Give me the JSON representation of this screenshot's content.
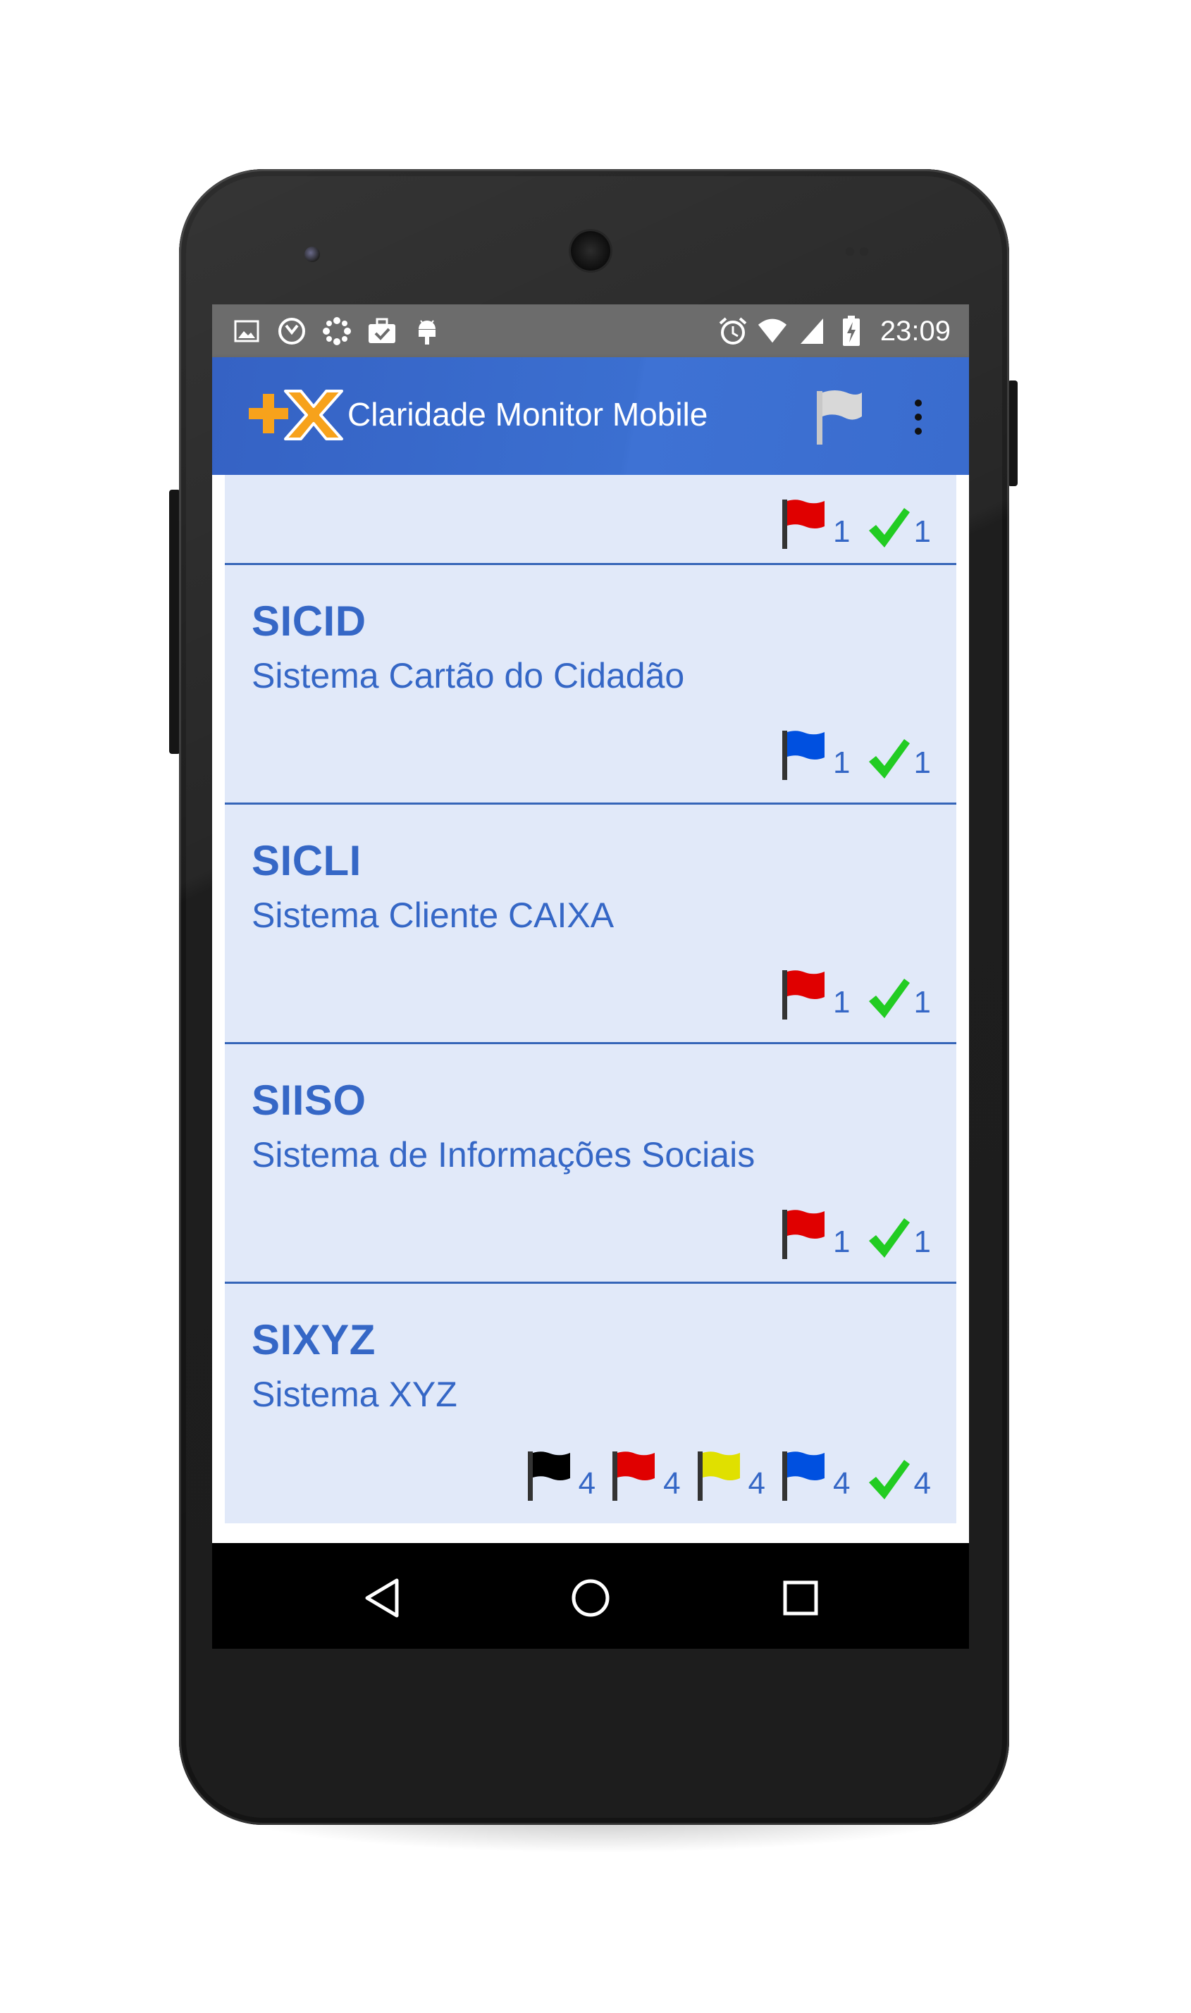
{
  "status_bar": {
    "time": "23:09",
    "left_icons": [
      "image-icon",
      "clock-app-icon",
      "dots-icon",
      "briefcase-check-icon",
      "android-debug-icon"
    ],
    "right_icons": [
      "alarm-icon",
      "wifi-icon",
      "signal-icon",
      "battery-charging-icon"
    ]
  },
  "app_bar": {
    "title": "Claridade Monitor Mobile",
    "logo": "plus-x-logo",
    "actions": [
      "flag-filter-icon",
      "overflow-menu-icon"
    ]
  },
  "colors": {
    "app_bar": "#3a6cce",
    "card_background": "#e1e9f9",
    "text_blue": "#3567c6",
    "flag_red": "#e00000",
    "flag_blue": "#0050e0",
    "flag_yellow": "#e0e000",
    "flag_black": "#000000",
    "check_green": "#22cc22"
  },
  "systems": [
    {
      "code": "",
      "name": "",
      "counters": [
        {
          "type": "red-flag",
          "count": "1"
        },
        {
          "type": "check",
          "count": "1"
        }
      ]
    },
    {
      "code": "SICID",
      "name": "Sistema Cartão do Cidadão",
      "counters": [
        {
          "type": "blue-flag",
          "count": "1"
        },
        {
          "type": "check",
          "count": "1"
        }
      ]
    },
    {
      "code": "SICLI",
      "name": "Sistema Cliente CAIXA",
      "counters": [
        {
          "type": "red-flag",
          "count": "1"
        },
        {
          "type": "check",
          "count": "1"
        }
      ]
    },
    {
      "code": "SIISO",
      "name": "Sistema de Informações Sociais",
      "counters": [
        {
          "type": "red-flag",
          "count": "1"
        },
        {
          "type": "check",
          "count": "1"
        }
      ]
    },
    {
      "code": "SIXYZ",
      "name": "Sistema XYZ",
      "counters": [
        {
          "type": "black-flag",
          "count": "4"
        },
        {
          "type": "red-flag",
          "count": "4"
        },
        {
          "type": "yellow-flag",
          "count": "4"
        },
        {
          "type": "blue-flag",
          "count": "4"
        },
        {
          "type": "check",
          "count": "4"
        }
      ]
    }
  ],
  "nav_bar": {
    "buttons": [
      "back-icon",
      "home-icon",
      "recents-icon"
    ]
  }
}
